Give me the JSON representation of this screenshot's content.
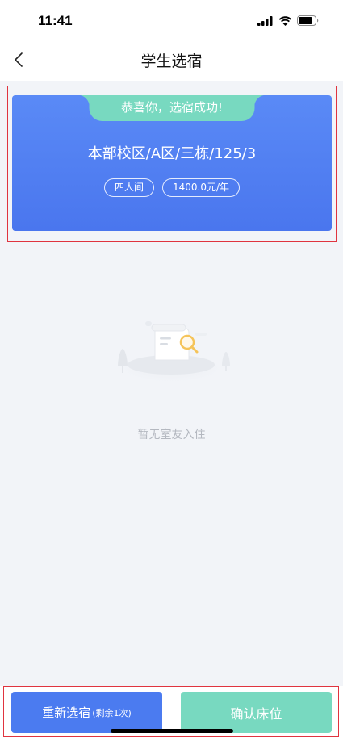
{
  "status": {
    "time": "11:41"
  },
  "nav": {
    "title": "学生选宿"
  },
  "card": {
    "banner": "恭喜你，选宿成功!",
    "room": "本部校区/A区/三栋/125/3",
    "tags": [
      "四人间",
      "1400.0元/年"
    ]
  },
  "empty": {
    "text": "暂无室友入住"
  },
  "actions": {
    "reselect_label": "重新选宿",
    "reselect_remaining": "(剩余1次)",
    "confirm_label": "确认床位"
  },
  "colors": {
    "primary": "#4b7bf0",
    "accent": "#78d9c0",
    "highlight": "#e0343f"
  }
}
